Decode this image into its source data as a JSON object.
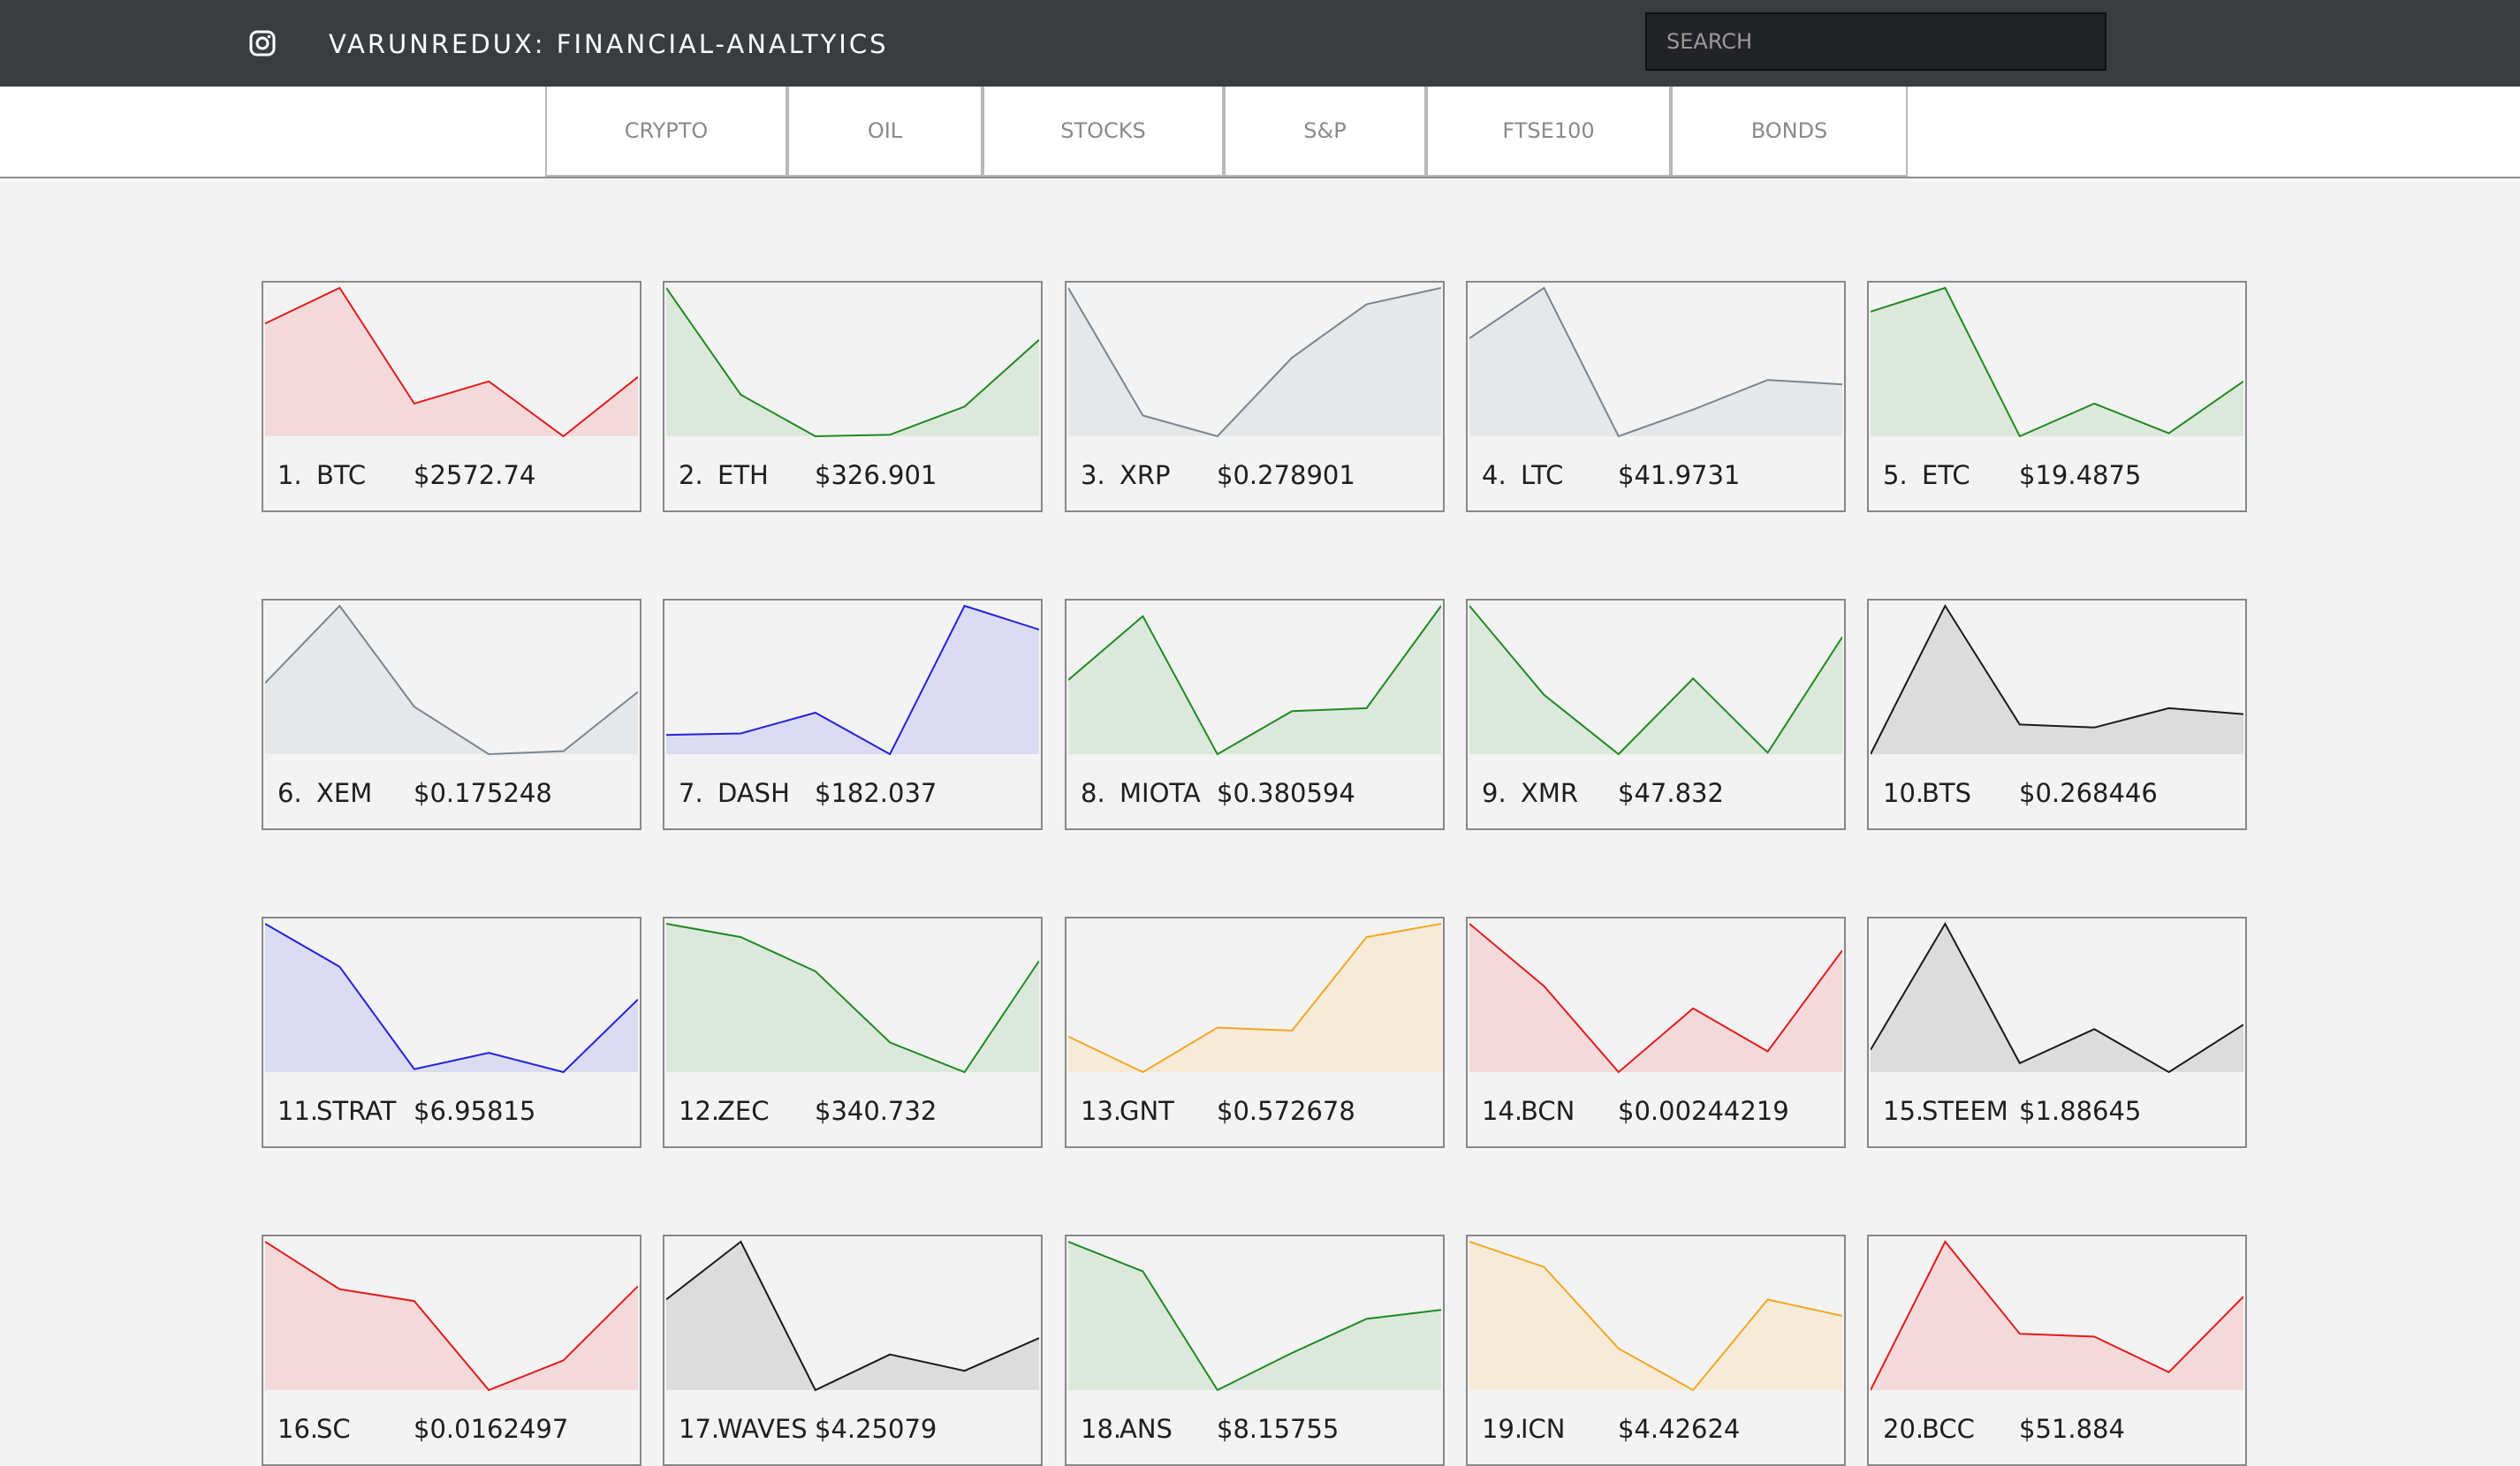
{
  "header": {
    "title": "VARUNREDUX: FINANCIAL-ANALTYICS",
    "search_placeholder": "SEARCH",
    "search_value": ""
  },
  "tabs": [
    "CRYPTO",
    "OIL",
    "STOCKS",
    "S&P",
    "FTSE100",
    "BONDS"
  ],
  "icons": {
    "logo": "instagram-icon"
  },
  "colors": {
    "red": "#e21b1b",
    "green": "#1f8a1f",
    "gray": "#7b858f",
    "blue": "#2222dd",
    "black": "#1a1a1a",
    "orange": "#f5a623"
  },
  "cards": [
    {
      "rank": "1.",
      "symbol": "BTC",
      "price": "$2572.74",
      "color": "red",
      "values": [
        76,
        100,
        22,
        37,
        0,
        40
      ]
    },
    {
      "rank": "2.",
      "symbol": "ETH",
      "price": "$326.901",
      "color": "green",
      "values": [
        100,
        28,
        0,
        1,
        20,
        65
      ]
    },
    {
      "rank": "3.",
      "symbol": "XRP",
      "price": "$0.278901",
      "color": "gray",
      "values": [
        100,
        14,
        0,
        53,
        89,
        100
      ]
    },
    {
      "rank": "4.",
      "symbol": "LTC",
      "price": "$41.9731",
      "color": "gray",
      "values": [
        66,
        100,
        0,
        18,
        38,
        35
      ]
    },
    {
      "rank": "5.",
      "symbol": "ETC",
      "price": "$19.4875",
      "color": "green",
      "values": [
        84,
        100,
        0,
        22,
        2,
        37
      ]
    },
    {
      "rank": "6.",
      "symbol": "XEM",
      "price": "$0.175248",
      "color": "gray",
      "values": [
        48,
        100,
        32,
        0,
        2,
        42
      ]
    },
    {
      "rank": "7.",
      "symbol": "DASH",
      "price": "$182.037",
      "color": "blue",
      "values": [
        13,
        14,
        28,
        0,
        100,
        84
      ]
    },
    {
      "rank": "8.",
      "symbol": "MIOTA",
      "price": "$0.380594",
      "color": "green",
      "values": [
        50,
        93,
        0,
        29,
        31,
        100
      ]
    },
    {
      "rank": "9.",
      "symbol": "XMR",
      "price": "$47.832",
      "color": "green",
      "values": [
        100,
        40,
        0,
        51,
        1,
        79
      ]
    },
    {
      "rank": "10.",
      "symbol": "BTS",
      "price": "$0.268446",
      "color": "black",
      "values": [
        0,
        100,
        20,
        18,
        31,
        27
      ]
    },
    {
      "rank": "11.",
      "symbol": "STRAT",
      "price": "$6.95815",
      "color": "blue",
      "values": [
        100,
        71,
        2,
        13,
        0,
        49
      ]
    },
    {
      "rank": "12.",
      "symbol": "ZEC",
      "price": "$340.732",
      "color": "green",
      "values": [
        100,
        91,
        68,
        20,
        0,
        75
      ]
    },
    {
      "rank": "13.",
      "symbol": "GNT",
      "price": "$0.572678",
      "color": "orange",
      "values": [
        24,
        0,
        30,
        28,
        91,
        100
      ]
    },
    {
      "rank": "14.",
      "symbol": "BCN",
      "price": "$0.00244219",
      "color": "red",
      "values": [
        100,
        58,
        0,
        43,
        14,
        82
      ]
    },
    {
      "rank": "15.",
      "symbol": "STEEM",
      "price": "$1.88645",
      "color": "black",
      "values": [
        15,
        100,
        6,
        29,
        0,
        32
      ]
    },
    {
      "rank": "16.",
      "symbol": "SC",
      "price": "$0.0162497",
      "color": "red",
      "values": [
        100,
        68,
        60,
        0,
        20,
        70
      ]
    },
    {
      "rank": "17.",
      "symbol": "WAVES",
      "price": "$4.25079",
      "color": "black",
      "values": [
        61,
        100,
        0,
        24,
        13,
        35
      ]
    },
    {
      "rank": "18.",
      "symbol": "ANS",
      "price": "$8.15755",
      "color": "green",
      "values": [
        100,
        80,
        0,
        25,
        48,
        54
      ]
    },
    {
      "rank": "19.",
      "symbol": "ICN",
      "price": "$4.42624",
      "color": "orange",
      "values": [
        100,
        83,
        28,
        0,
        61,
        50
      ]
    },
    {
      "rank": "20.",
      "symbol": "BCC",
      "price": "$51.884",
      "color": "red",
      "values": [
        0,
        100,
        38,
        36,
        12,
        63
      ]
    }
  ]
}
